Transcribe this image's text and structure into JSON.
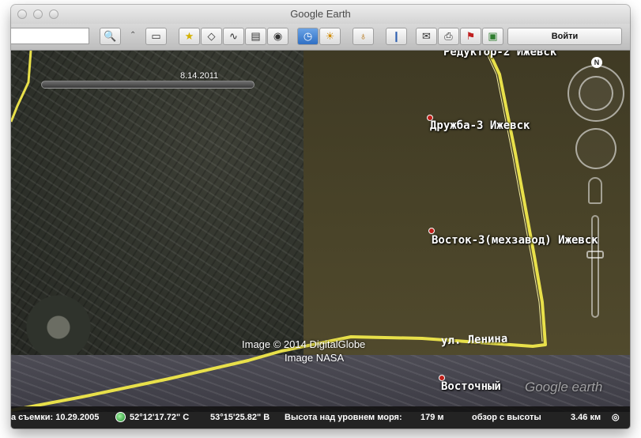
{
  "window": {
    "title": "Google Earth"
  },
  "toolbar": {
    "search_value": "",
    "login_label": "Войти",
    "buttons": [
      {
        "name": "search-icon",
        "glyph": "🔍"
      },
      {
        "name": "sidebar-toggle-icon",
        "glyph": "▭"
      },
      {
        "name": "add-placemark-icon",
        "glyph": "★"
      },
      {
        "name": "add-polygon-icon",
        "glyph": "◇"
      },
      {
        "name": "add-path-icon",
        "glyph": "∿"
      },
      {
        "name": "add-overlay-icon",
        "glyph": "▤"
      },
      {
        "name": "record-tour-icon",
        "glyph": "◉"
      },
      {
        "name": "historical-imagery-icon",
        "glyph": "◷"
      },
      {
        "name": "sunlight-icon",
        "glyph": "☀"
      },
      {
        "name": "switch-planet-icon",
        "glyph": "♁"
      },
      {
        "name": "ruler-icon",
        "glyph": "❙"
      },
      {
        "name": "email-icon",
        "glyph": "✉"
      },
      {
        "name": "print-icon",
        "glyph": "⎙"
      },
      {
        "name": "maps-icon",
        "glyph": "⚑"
      },
      {
        "name": "save-image-icon",
        "glyph": "▣"
      }
    ]
  },
  "map": {
    "time_slider_date": "8.14.2011",
    "placemarks": [
      {
        "label": "Редуктор-2 Ижевск"
      },
      {
        "label": "Дружба-3 Ижевск"
      },
      {
        "label": "Восток-3(мехзавод) Ижевск"
      },
      {
        "label": "Восточный"
      }
    ],
    "street_label": "ул. Ленина",
    "credit_digitalglobe": "Image © 2014 DigitalGlobe",
    "credit_nasa": "Image NASA",
    "watermark": "Google earth",
    "compass_n": "N"
  },
  "statusbar": {
    "date_label": "а съемки: 10.29.2005",
    "lon": "52°12'17.72\" С",
    "lat": "53°15'25.82\" В",
    "elevation_label": "Высота над уровнем моря:",
    "elevation_value": "179 м",
    "eye_alt_label": "обзор с высоты",
    "eye_alt_value": "3.46 км"
  },
  "colors": {
    "road": "#e8e04a",
    "pin": "#c0201b"
  }
}
